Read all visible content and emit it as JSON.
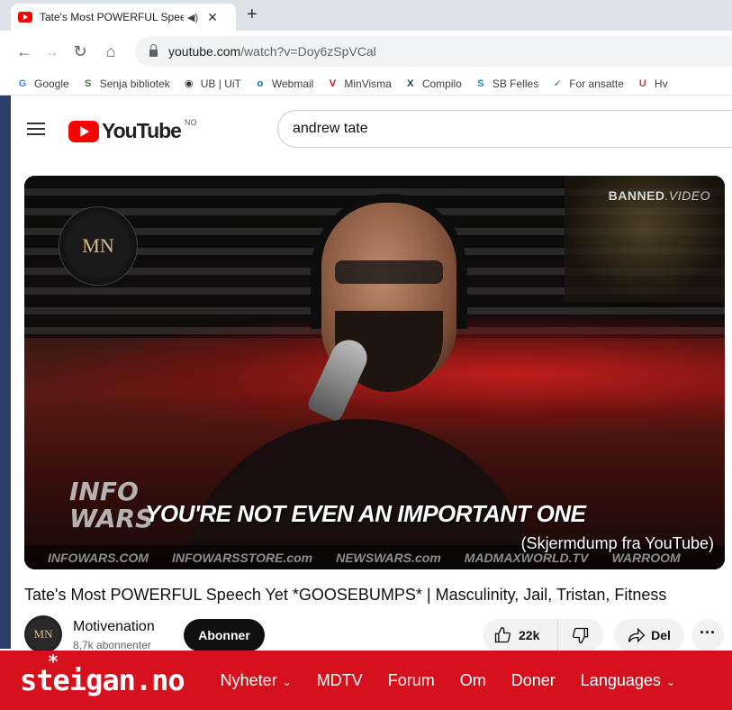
{
  "browser": {
    "tab": {
      "title": "Tate's Most POWERFUL Spee",
      "audio_icon": "speaker-icon",
      "close_label": "✕"
    },
    "new_tab_label": "+",
    "url_host": "youtube.com",
    "url_path": "/watch?v=Doy6zSpVCal",
    "bookmarks": [
      {
        "label": "Google",
        "icon": "G",
        "color": "#4285f4"
      },
      {
        "label": "Senja bibliotek",
        "icon": "S",
        "color": "#3b7a3b"
      },
      {
        "label": "UB | UiT",
        "icon": "◉",
        "color": "#333333"
      },
      {
        "label": "Webmail",
        "icon": "o",
        "color": "#0f6cbd"
      },
      {
        "label": "MinVisma",
        "icon": "V",
        "color": "#c8102e"
      },
      {
        "label": "Compilo",
        "icon": "X",
        "color": "#1d3a4a"
      },
      {
        "label": "SB Felles",
        "icon": "S",
        "color": "#1e88b5"
      },
      {
        "label": "For ansatte",
        "icon": "✓",
        "color": "#2e7d32"
      },
      {
        "label": "Hv",
        "icon": "U",
        "color": "#c0392b"
      }
    ]
  },
  "youtube": {
    "logo_text": "YouTube",
    "region": "NO",
    "search_value": "andrew tate"
  },
  "video": {
    "watermark": "BANNED",
    "watermark_suffix": ".VIDEO",
    "channel_logo": "MN",
    "overlay_logo": "INFO WARS",
    "caption": "YOU'RE NOT EVEN AN IMPORTANT ONE",
    "ticker": [
      "INFOWARS.COM",
      "INFOWARSSTORE.com",
      "NEWSWARS.com",
      "MADMAXWORLD.TV",
      "WARROOM"
    ],
    "credit": "(Skjermdump fra YouTube)",
    "title": "Tate's Most POWERFUL Speech Yet *GOOSEBUMPS* | Masculinity, Jail, Tristan, Fitness"
  },
  "channel": {
    "avatar": "MN",
    "name": "Motivenation",
    "subscribers": "8,7k abonnenter",
    "subscribe_label": "Abonner",
    "likes": "22k",
    "share_label": "Del",
    "more_label": "···"
  },
  "steigan": {
    "logo": "steigan.no",
    "nav": [
      {
        "label": "Nyheter",
        "caret": "⌄"
      },
      {
        "label": "MDTV",
        "caret": ""
      },
      {
        "label": "Forum",
        "caret": ""
      },
      {
        "label": "Om",
        "caret": ""
      },
      {
        "label": "Doner",
        "caret": ""
      },
      {
        "label": "Languages",
        "caret": "⌄"
      }
    ]
  },
  "colors": {
    "youtube_red": "#ff0000",
    "steigan_red": "#d7101e"
  }
}
